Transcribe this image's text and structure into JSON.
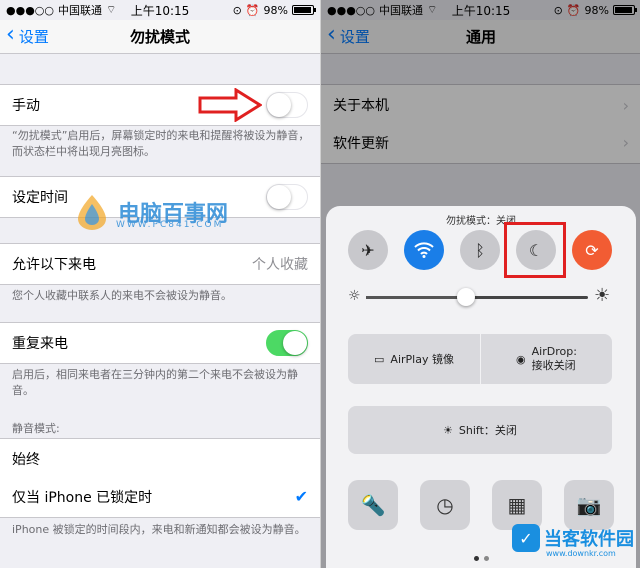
{
  "status": {
    "carrier": "中国联通",
    "time": "上午10:15",
    "battery": "98%"
  },
  "left": {
    "nav": {
      "back": "设置",
      "title": "勿扰模式"
    },
    "manual": {
      "label": "手动",
      "on": false
    },
    "manual_footer": "“勿扰模式”启用后，屏幕锁定时的来电和提醒将被设为静音，而状态栏中将出现月亮图标。",
    "scheduled": {
      "label": "设定时间",
      "on": false
    },
    "allow_calls": {
      "label": "允许以下来电",
      "value": "个人收藏"
    },
    "allow_footer": "您个人收藏中联系人的来电不会被设为静音。",
    "repeated": {
      "label": "重复来电",
      "on": true
    },
    "repeated_footer": "启用后，相同来电者在三分钟内的第二个来电不会被设为静音。",
    "silence_header": "静音模式:",
    "always": {
      "label": "始终"
    },
    "locked": {
      "label": "仅当 iPhone 已锁定时",
      "selected": true
    },
    "locked_footer": "iPhone 被锁定的时间段内，来电和新通知都会被设为静音。"
  },
  "watermark": {
    "text": "电脑百事网",
    "sub": "WWW.PC841.COM"
  },
  "right": {
    "nav": {
      "back": "设置",
      "title": "通用"
    },
    "rows": [
      "关于本机",
      "软件更新"
    ],
    "control_center": {
      "title": "勿扰模式：关闭",
      "brightness": 0.45,
      "airplay": "AirPlay 镜像",
      "airdrop_line1": "AirDrop:",
      "airdrop_line2": "接收关闭",
      "night_shift_partial": "Shift：关闭"
    }
  },
  "logo": {
    "text": "当客软件园",
    "sub": "www.downkr.com"
  },
  "colors": {
    "ios_blue": "#007aff",
    "switch_green": "#4cd964",
    "highlight_red": "#e02020"
  }
}
